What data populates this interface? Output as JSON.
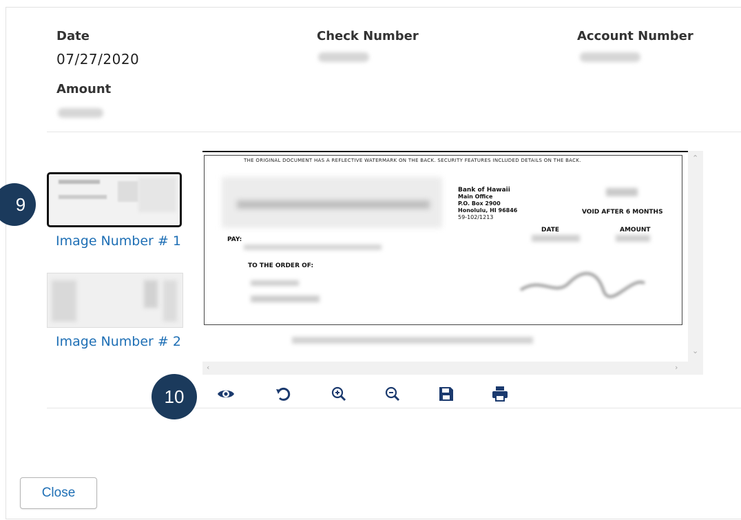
{
  "details": {
    "date_label": "Date",
    "date_value": "07/27/2020",
    "check_number_label": "Check Number",
    "account_number_label": "Account Number",
    "amount_label": "Amount"
  },
  "images": [
    {
      "label": "Image Number # 1",
      "selected": true
    },
    {
      "label": "Image Number # 2",
      "selected": false
    }
  ],
  "check_image": {
    "header_note": "THE ORIGINAL DOCUMENT HAS A REFLECTIVE WATERMARK ON THE BACK.  SECURITY FEATURES INCLUDED DETAILS ON THE BACK.",
    "bank_lines": [
      "Bank of Hawaii",
      "Main Office",
      "P.O. Box 2900",
      "Honolulu, HI 96846",
      "59-102/1213"
    ],
    "void_text": "VOID AFTER 6 MONTHS",
    "date_label": "DATE",
    "amount_label": "AMOUNT",
    "pay_label": "PAY:",
    "order_label": "TO THE ORDER OF:"
  },
  "toolbar": {
    "icons": [
      "eye-icon",
      "rotate-icon",
      "zoom-in-icon",
      "zoom-out-icon",
      "save-icon",
      "print-icon"
    ],
    "icon_color": "#1b3a6e"
  },
  "callouts": [
    "9",
    "10"
  ],
  "close_label": "Close"
}
